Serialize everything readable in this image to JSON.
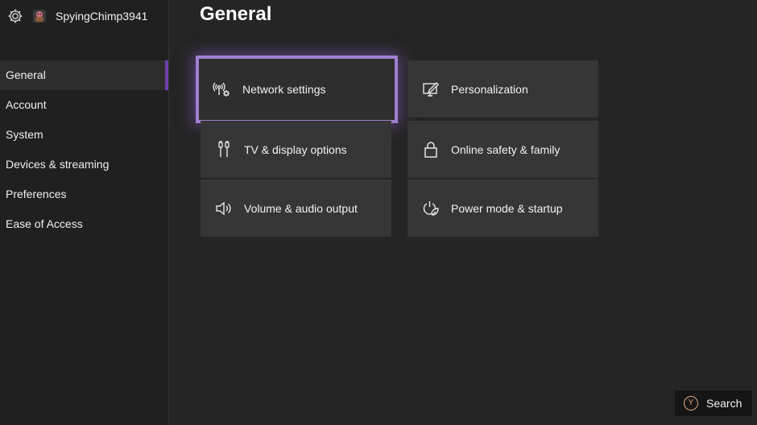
{
  "profile": {
    "gamertag": "SpyingChimp3941"
  },
  "sidebar": {
    "items": [
      {
        "label": "General",
        "active": true
      },
      {
        "label": "Account"
      },
      {
        "label": "System"
      },
      {
        "label": "Devices & streaming"
      },
      {
        "label": "Preferences"
      },
      {
        "label": "Ease of Access"
      }
    ]
  },
  "main": {
    "title": "General",
    "tiles": [
      {
        "label": "Network settings",
        "icon": "network-icon",
        "focused": true
      },
      {
        "label": "Personalization",
        "icon": "personalization-icon"
      },
      {
        "label": "TV & display options",
        "icon": "tv-display-icon"
      },
      {
        "label": "Online safety & family",
        "icon": "lock-icon"
      },
      {
        "label": "Volume & audio output",
        "icon": "speaker-icon"
      },
      {
        "label": "Power mode & startup",
        "icon": "power-icon"
      }
    ]
  },
  "footer": {
    "search_label": "Search",
    "search_button_glyph": "Y"
  },
  "colors": {
    "accent": "#6f3fae",
    "focus_outline": "#a07fd0",
    "y_button": "#e3a77a"
  }
}
